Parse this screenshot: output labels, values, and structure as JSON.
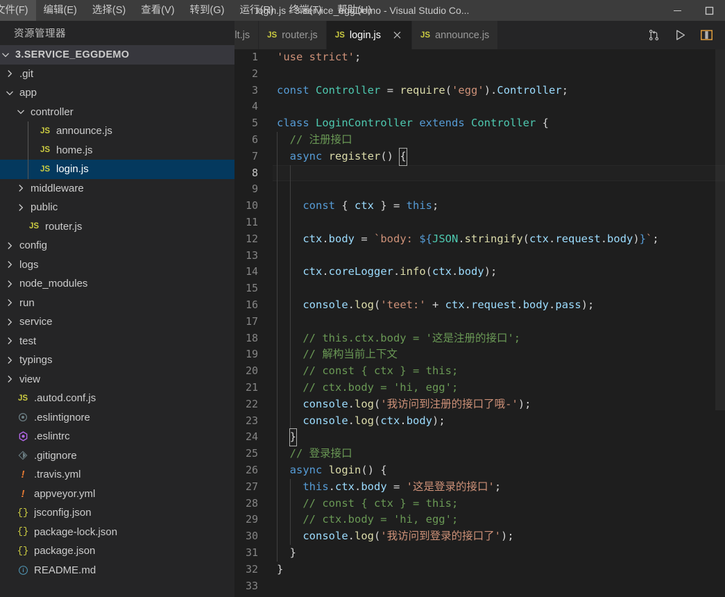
{
  "window": {
    "title": "login.js - 3.service_eggDemo - Visual Studio Co...",
    "minimize_label": "minimize",
    "maximize_label": "maximize"
  },
  "menu": {
    "items": [
      {
        "label": "文件(F)"
      },
      {
        "label": "编辑(E)"
      },
      {
        "label": "选择(S)"
      },
      {
        "label": "查看(V)"
      },
      {
        "label": "转到(G)"
      },
      {
        "label": "运行(R)"
      },
      {
        "label": "终端(T)"
      },
      {
        "label": "帮助(H)"
      }
    ]
  },
  "sidebar": {
    "title": "资源管理器",
    "root": {
      "label": "3.SERVICE_EGGDEMO",
      "expanded": true
    },
    "items": [
      {
        "label": ".git",
        "type": "folder",
        "depth": 1,
        "expanded": false
      },
      {
        "label": "app",
        "type": "folder",
        "depth": 1,
        "expanded": true
      },
      {
        "label": "controller",
        "type": "folder",
        "depth": 2,
        "expanded": true
      },
      {
        "label": "announce.js",
        "type": "js",
        "depth": 3,
        "icon": "js-file-icon"
      },
      {
        "label": "home.js",
        "type": "js",
        "depth": 3,
        "icon": "js-file-icon"
      },
      {
        "label": "login.js",
        "type": "js",
        "depth": 3,
        "icon": "js-file-icon",
        "selected": true
      },
      {
        "label": "middleware",
        "type": "folder",
        "depth": 2,
        "expanded": false
      },
      {
        "label": "public",
        "type": "folder",
        "depth": 2,
        "expanded": false
      },
      {
        "label": "router.js",
        "type": "js",
        "depth": 2,
        "icon": "js-file-icon"
      },
      {
        "label": "config",
        "type": "folder",
        "depth": 1,
        "expanded": false
      },
      {
        "label": "logs",
        "type": "folder",
        "depth": 1,
        "expanded": false
      },
      {
        "label": "node_modules",
        "type": "folder",
        "depth": 1,
        "expanded": false
      },
      {
        "label": "run",
        "type": "folder",
        "depth": 1,
        "expanded": false
      },
      {
        "label": "service",
        "type": "folder",
        "depth": 1,
        "expanded": false
      },
      {
        "label": "test",
        "type": "folder",
        "depth": 1,
        "expanded": false
      },
      {
        "label": "typings",
        "type": "folder",
        "depth": 1,
        "expanded": false
      },
      {
        "label": "view",
        "type": "folder",
        "depth": 1,
        "expanded": false
      },
      {
        "label": ".autod.conf.js",
        "type": "js",
        "depth": 1,
        "icon": "js-file-icon"
      },
      {
        "label": ".eslintignore",
        "type": "eslintignore",
        "depth": 1,
        "icon": "eslint-ignore-icon"
      },
      {
        "label": ".eslintrc",
        "type": "eslintrc",
        "depth": 1,
        "icon": "eslint-icon"
      },
      {
        "label": ".gitignore",
        "type": "gitignore",
        "depth": 1,
        "icon": "git-icon"
      },
      {
        "label": ".travis.yml",
        "type": "yml",
        "depth": 1,
        "icon": "yaml-icon"
      },
      {
        "label": "appveyor.yml",
        "type": "yml",
        "depth": 1,
        "icon": "yaml-icon"
      },
      {
        "label": "jsconfig.json",
        "type": "json",
        "depth": 1,
        "icon": "json-icon"
      },
      {
        "label": "package-lock.json",
        "type": "json",
        "depth": 1,
        "icon": "json-icon"
      },
      {
        "label": "package.json",
        "type": "json",
        "depth": 1,
        "icon": "json-icon"
      },
      {
        "label": "README.md",
        "type": "md",
        "depth": 1,
        "icon": "markdown-icon"
      }
    ]
  },
  "tabs": {
    "items": [
      {
        "label": "g.default.js",
        "icon": "",
        "active": false,
        "closable": false
      },
      {
        "label": "router.js",
        "icon": "JS",
        "active": false,
        "closable": false
      },
      {
        "label": "login.js",
        "icon": "JS",
        "active": true,
        "closable": true
      },
      {
        "label": "announce.js",
        "icon": "JS",
        "active": false,
        "closable": false
      }
    ],
    "actions": [
      {
        "name": "split-changes-icon",
        "title": "source-control-compare"
      },
      {
        "name": "run-icon",
        "title": "run"
      },
      {
        "name": "split-editor-icon",
        "title": "split-editor-right"
      }
    ]
  },
  "editor": {
    "language": "javascript",
    "current_line": 8,
    "first_visible_line": 1,
    "last_visible_line": 33,
    "lines": [
      {
        "n": 1,
        "tokens": [
          {
            "t": "str",
            "v": "'use strict'"
          },
          {
            "t": "plain",
            "v": ";"
          }
        ]
      },
      {
        "n": 2,
        "tokens": []
      },
      {
        "n": 3,
        "tokens": [
          {
            "t": "key",
            "v": "const"
          },
          {
            "t": "plain",
            "v": " "
          },
          {
            "t": "cls",
            "v": "Controller"
          },
          {
            "t": "plain",
            "v": " "
          },
          {
            "t": "plain",
            "v": "= "
          },
          {
            "t": "fn",
            "v": "require"
          },
          {
            "t": "plain",
            "v": "("
          },
          {
            "t": "str",
            "v": "'egg'"
          },
          {
            "t": "plain",
            "v": ")."
          },
          {
            "t": "var",
            "v": "Controller"
          },
          {
            "t": "plain",
            "v": ";"
          }
        ]
      },
      {
        "n": 4,
        "tokens": []
      },
      {
        "n": 5,
        "tokens": [
          {
            "t": "key",
            "v": "class"
          },
          {
            "t": "plain",
            "v": " "
          },
          {
            "t": "cls",
            "v": "LoginController"
          },
          {
            "t": "plain",
            "v": " "
          },
          {
            "t": "key",
            "v": "extends"
          },
          {
            "t": "plain",
            "v": " "
          },
          {
            "t": "cls",
            "v": "Controller"
          },
          {
            "t": "plain",
            "v": " {"
          }
        ]
      },
      {
        "n": 6,
        "tokens": [
          {
            "t": "cmt",
            "v": "  // 注册接口"
          }
        ]
      },
      {
        "n": 7,
        "tokens": [
          {
            "t": "plain",
            "v": "  "
          },
          {
            "t": "key",
            "v": "async"
          },
          {
            "t": "plain",
            "v": " "
          },
          {
            "t": "fn",
            "v": "register"
          },
          {
            "t": "plain",
            "v": "() "
          },
          {
            "t": "cursor",
            "v": "{"
          }
        ]
      },
      {
        "n": 8,
        "tokens": []
      },
      {
        "n": 9,
        "tokens": []
      },
      {
        "n": 10,
        "tokens": [
          {
            "t": "plain",
            "v": "    "
          },
          {
            "t": "key",
            "v": "const"
          },
          {
            "t": "plain",
            "v": " { "
          },
          {
            "t": "var",
            "v": "ctx"
          },
          {
            "t": "plain",
            "v": " } = "
          },
          {
            "t": "key",
            "v": "this"
          },
          {
            "t": "plain",
            "v": ";"
          }
        ]
      },
      {
        "n": 11,
        "tokens": []
      },
      {
        "n": 12,
        "tokens": [
          {
            "t": "plain",
            "v": "    "
          },
          {
            "t": "var",
            "v": "ctx"
          },
          {
            "t": "plain",
            "v": "."
          },
          {
            "t": "var",
            "v": "body"
          },
          {
            "t": "plain",
            "v": " = "
          },
          {
            "t": "str",
            "v": "`body: "
          },
          {
            "t": "key",
            "v": "${"
          },
          {
            "t": "cls",
            "v": "JSON"
          },
          {
            "t": "plain",
            "v": "."
          },
          {
            "t": "fn",
            "v": "stringify"
          },
          {
            "t": "plain",
            "v": "("
          },
          {
            "t": "var",
            "v": "ctx"
          },
          {
            "t": "plain",
            "v": "."
          },
          {
            "t": "var",
            "v": "request"
          },
          {
            "t": "plain",
            "v": "."
          },
          {
            "t": "var",
            "v": "body"
          },
          {
            "t": "plain",
            "v": ")"
          },
          {
            "t": "key",
            "v": "}"
          },
          {
            "t": "str",
            "v": "`"
          },
          {
            "t": "plain",
            "v": ";"
          }
        ]
      },
      {
        "n": 13,
        "tokens": []
      },
      {
        "n": 14,
        "tokens": [
          {
            "t": "plain",
            "v": "    "
          },
          {
            "t": "var",
            "v": "ctx"
          },
          {
            "t": "plain",
            "v": "."
          },
          {
            "t": "var",
            "v": "coreLogger"
          },
          {
            "t": "plain",
            "v": "."
          },
          {
            "t": "fn",
            "v": "info"
          },
          {
            "t": "plain",
            "v": "("
          },
          {
            "t": "var",
            "v": "ctx"
          },
          {
            "t": "plain",
            "v": "."
          },
          {
            "t": "var",
            "v": "body"
          },
          {
            "t": "plain",
            "v": ");"
          }
        ]
      },
      {
        "n": 15,
        "tokens": []
      },
      {
        "n": 16,
        "tokens": [
          {
            "t": "plain",
            "v": "    "
          },
          {
            "t": "var",
            "v": "console"
          },
          {
            "t": "plain",
            "v": "."
          },
          {
            "t": "fn",
            "v": "log"
          },
          {
            "t": "plain",
            "v": "("
          },
          {
            "t": "str",
            "v": "'teet:'"
          },
          {
            "t": "plain",
            "v": " + "
          },
          {
            "t": "var",
            "v": "ctx"
          },
          {
            "t": "plain",
            "v": "."
          },
          {
            "t": "var",
            "v": "request"
          },
          {
            "t": "plain",
            "v": "."
          },
          {
            "t": "var",
            "v": "body"
          },
          {
            "t": "plain",
            "v": "."
          },
          {
            "t": "var",
            "v": "pass"
          },
          {
            "t": "plain",
            "v": ");"
          }
        ]
      },
      {
        "n": 17,
        "tokens": []
      },
      {
        "n": 18,
        "tokens": [
          {
            "t": "cmt",
            "v": "    // this.ctx.body = '这是注册的接口';"
          }
        ]
      },
      {
        "n": 19,
        "tokens": [
          {
            "t": "cmt",
            "v": "    // 解构当前上下文"
          }
        ]
      },
      {
        "n": 20,
        "tokens": [
          {
            "t": "cmt",
            "v": "    // const { ctx } = this;"
          }
        ]
      },
      {
        "n": 21,
        "tokens": [
          {
            "t": "cmt",
            "v": "    // ctx.body = 'hi, egg';"
          }
        ]
      },
      {
        "n": 22,
        "tokens": [
          {
            "t": "plain",
            "v": "    "
          },
          {
            "t": "var",
            "v": "console"
          },
          {
            "t": "plain",
            "v": "."
          },
          {
            "t": "fn",
            "v": "log"
          },
          {
            "t": "plain",
            "v": "("
          },
          {
            "t": "str",
            "v": "'我访问到注册的接口了哦-'"
          },
          {
            "t": "plain",
            "v": ");"
          }
        ]
      },
      {
        "n": 23,
        "tokens": [
          {
            "t": "plain",
            "v": "    "
          },
          {
            "t": "var",
            "v": "console"
          },
          {
            "t": "plain",
            "v": "."
          },
          {
            "t": "fn",
            "v": "log"
          },
          {
            "t": "plain",
            "v": "("
          },
          {
            "t": "var",
            "v": "ctx"
          },
          {
            "t": "plain",
            "v": "."
          },
          {
            "t": "var",
            "v": "body"
          },
          {
            "t": "plain",
            "v": ");"
          }
        ]
      },
      {
        "n": 24,
        "tokens": [
          {
            "t": "plain",
            "v": "  "
          },
          {
            "t": "cursor",
            "v": "}"
          }
        ]
      },
      {
        "n": 25,
        "tokens": [
          {
            "t": "cmt",
            "v": "  // 登录接口"
          }
        ]
      },
      {
        "n": 26,
        "tokens": [
          {
            "t": "plain",
            "v": "  "
          },
          {
            "t": "key",
            "v": "async"
          },
          {
            "t": "plain",
            "v": " "
          },
          {
            "t": "fn",
            "v": "login"
          },
          {
            "t": "plain",
            "v": "() {"
          }
        ]
      },
      {
        "n": 27,
        "tokens": [
          {
            "t": "plain",
            "v": "    "
          },
          {
            "t": "key",
            "v": "this"
          },
          {
            "t": "plain",
            "v": "."
          },
          {
            "t": "var",
            "v": "ctx"
          },
          {
            "t": "plain",
            "v": "."
          },
          {
            "t": "var",
            "v": "body"
          },
          {
            "t": "plain",
            "v": " = "
          },
          {
            "t": "str",
            "v": "'这是登录的接口'"
          },
          {
            "t": "plain",
            "v": ";"
          }
        ]
      },
      {
        "n": 28,
        "tokens": [
          {
            "t": "cmt",
            "v": "    // const { ctx } = this;"
          }
        ]
      },
      {
        "n": 29,
        "tokens": [
          {
            "t": "cmt",
            "v": "    // ctx.body = 'hi, egg';"
          }
        ]
      },
      {
        "n": 30,
        "tokens": [
          {
            "t": "plain",
            "v": "    "
          },
          {
            "t": "var",
            "v": "console"
          },
          {
            "t": "plain",
            "v": "."
          },
          {
            "t": "fn",
            "v": "log"
          },
          {
            "t": "plain",
            "v": "("
          },
          {
            "t": "str",
            "v": "'我访问到登录的接口了'"
          },
          {
            "t": "plain",
            "v": ");"
          }
        ]
      },
      {
        "n": 31,
        "tokens": [
          {
            "t": "plain",
            "v": "  }"
          }
        ]
      },
      {
        "n": 32,
        "tokens": [
          {
            "t": "plain",
            "v": "}"
          }
        ]
      },
      {
        "n": 33,
        "tokens": []
      }
    ]
  },
  "colors": {
    "editor_bg": "#1e1e1e",
    "sidebar_bg": "#252526",
    "titlebar_bg": "#3c3c3c",
    "tab_inactive_bg": "#2d2d2d",
    "selection_blue": "#04395e",
    "keyword": "#569cd6",
    "string": "#ce9178",
    "comment": "#6a9955",
    "function": "#dcdcaa",
    "class": "#4ec9b0",
    "variable": "#9cdcfe"
  }
}
